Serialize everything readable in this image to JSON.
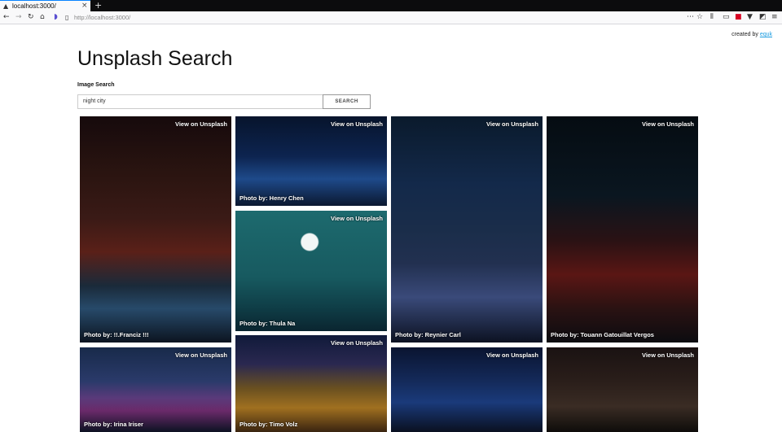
{
  "browser": {
    "tab_title": "localhost:3000/",
    "new_tab": "+",
    "close_tab": "×",
    "url": "http://localhost:3000/"
  },
  "page": {
    "created_by_prefix": "created by",
    "created_by_link": "equk",
    "title": "Unsplash Search",
    "search_label": "Image Search",
    "search_value": "night city",
    "search_button": "SEARCH"
  },
  "photos": [
    {
      "view": "View on Unsplash",
      "credit": "Photo by: !!.Franciz !!!"
    },
    {
      "view": "View on Unsplash",
      "credit": "Photo by: Henry Chen"
    },
    {
      "view": "View on Unsplash",
      "credit": "Photo by: Thula Na"
    },
    {
      "view": "View on Unsplash",
      "credit": "Photo by: Timo Volz"
    },
    {
      "view": "View on Unsplash",
      "credit": "Photo by: Reynier Carl"
    },
    {
      "view": "View on Unsplash",
      "credit": "Photo by: Touann Gatouillat Vergos"
    },
    {
      "view": "View on Unsplash",
      "credit": "Photo by: Irina Iriser"
    },
    {
      "view": "View on Unsplash",
      "credit": ""
    },
    {
      "view": "View on Unsplash",
      "credit": ""
    }
  ]
}
